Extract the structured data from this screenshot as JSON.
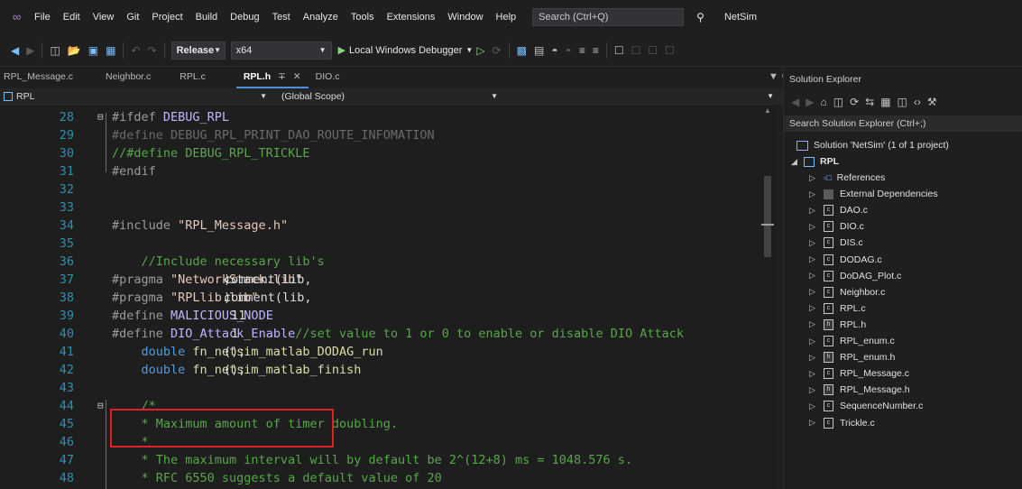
{
  "menubar": {
    "items": [
      "File",
      "Edit",
      "View",
      "Git",
      "Project",
      "Build",
      "Debug",
      "Test",
      "Analyze",
      "Tools",
      "Extensions",
      "Window",
      "Help"
    ],
    "search_placeholder": "Search (Ctrl+Q)",
    "solution_name": "NetSim"
  },
  "toolbar": {
    "configuration": "Release",
    "platform": "x64",
    "debugger_label": "Local Windows Debugger"
  },
  "tabs": [
    {
      "label": "RPL_Message.c",
      "active": false
    },
    {
      "label": "Neighbor.c",
      "active": false
    },
    {
      "label": "RPL.c",
      "active": false
    },
    {
      "label": "RPL.h",
      "active": true
    },
    {
      "label": "DIO.c",
      "active": false
    }
  ],
  "navbar": {
    "project": "RPL",
    "scope": "(Global Scope)"
  },
  "editor": {
    "lines": [
      {
        "n": "28",
        "parts": [
          [
            "pp",
            "#ifdef "
          ],
          [
            "mac",
            "DEBUG_RPL"
          ]
        ]
      },
      {
        "n": "29",
        "parts": [
          [
            "dim",
            "#define DEBUG_RPL_PRINT_DAO_ROUTE_INFOMATION"
          ]
        ]
      },
      {
        "n": "30",
        "parts": [
          [
            "cmt",
            "//#define DEBUG_RPL_TRICKLE"
          ]
        ]
      },
      {
        "n": "31",
        "parts": [
          [
            "pp",
            "#endif"
          ]
        ]
      },
      {
        "n": "32",
        "parts": []
      },
      {
        "n": "33",
        "parts": []
      },
      {
        "n": "34",
        "parts": [
          [
            "pp",
            "#include "
          ],
          [
            "str",
            "\"RPL_Message.h\""
          ]
        ]
      },
      {
        "n": "35",
        "parts": []
      },
      {
        "n": "36",
        "parts": [
          [
            "cmt",
            "    //Include necessary lib's"
          ]
        ]
      },
      {
        "n": "37",
        "parts": [
          [
            "pp",
            "#pragma "
          ],
          [
            "code",
            "comment(lib,"
          ],
          [
            "str",
            "\"NetworkStack.lib\""
          ],
          [
            "code",
            ")"
          ]
        ]
      },
      {
        "n": "38",
        "parts": [
          [
            "pp",
            "#pragma "
          ],
          [
            "code",
            "comment(lib,"
          ],
          [
            "str",
            "\"RPLlib.lib\""
          ],
          [
            "code",
            ")"
          ]
        ]
      },
      {
        "n": "39",
        "parts": [
          [
            "pp",
            "#define "
          ],
          [
            "mac",
            "MALICIOUS_NODE"
          ],
          [
            "code",
            " 11"
          ]
        ]
      },
      {
        "n": "40",
        "parts": [
          [
            "pp",
            "#define "
          ],
          [
            "mac",
            "DIO_Attack_Enable"
          ],
          [
            "code",
            " 1"
          ],
          [
            "cmt",
            "//set value to 1 or 0 to enable or disable DIO Attack"
          ]
        ]
      },
      {
        "n": "41",
        "parts": [
          [
            "kw",
            "    double "
          ],
          [
            "fn",
            "fn_netsim_matlab_DODAG_run"
          ],
          [
            "code",
            "();"
          ]
        ]
      },
      {
        "n": "42",
        "parts": [
          [
            "kw",
            "    double "
          ],
          [
            "fn",
            "fn_netsim_matlab_finish"
          ],
          [
            "code",
            "();"
          ]
        ]
      },
      {
        "n": "43",
        "parts": []
      },
      {
        "n": "44",
        "parts": [
          [
            "cmt",
            "    /*"
          ]
        ]
      },
      {
        "n": "45",
        "parts": [
          [
            "cmt",
            "    * Maximum amount of timer doubling."
          ]
        ]
      },
      {
        "n": "46",
        "parts": [
          [
            "cmt",
            "    *"
          ]
        ]
      },
      {
        "n": "47",
        "parts": [
          [
            "cmt",
            "    * The maximum interval will by default be 2^(12+8) ms = 1048.576 s."
          ]
        ]
      },
      {
        "n": "48",
        "parts": [
          [
            "cmt",
            "    * RFC 6550 suggests a default value of 20"
          ]
        ]
      }
    ]
  },
  "solution_explorer": {
    "title": "Solution Explorer",
    "search_placeholder": "Search Solution Explorer (Ctrl+;)",
    "solution_label": "Solution 'NetSim' (1 of 1 project)",
    "project_label": "RPL",
    "items": [
      {
        "label": "References",
        "kind": "ref"
      },
      {
        "label": "External Dependencies",
        "kind": "dep"
      },
      {
        "label": "DAO.c",
        "kind": "c"
      },
      {
        "label": "DIO.c",
        "kind": "c"
      },
      {
        "label": "DIS.c",
        "kind": "c"
      },
      {
        "label": "DODAG.c",
        "kind": "c"
      },
      {
        "label": "DoDAG_Plot.c",
        "kind": "c"
      },
      {
        "label": "Neighbor.c",
        "kind": "c"
      },
      {
        "label": "RPL.c",
        "kind": "c"
      },
      {
        "label": "RPL.h",
        "kind": "h"
      },
      {
        "label": "RPL_enum.c",
        "kind": "c"
      },
      {
        "label": "RPL_enum.h",
        "kind": "h"
      },
      {
        "label": "RPL_Message.c",
        "kind": "c"
      },
      {
        "label": "RPL_Message.h",
        "kind": "h"
      },
      {
        "label": "SequenceNumber.c",
        "kind": "c"
      },
      {
        "label": "Trickle.c",
        "kind": "c"
      }
    ]
  },
  "colors": {
    "highlight_box": "#e0202a",
    "line_numbers": "#2b91af",
    "active_tab_underline": "#4f8fdc"
  }
}
